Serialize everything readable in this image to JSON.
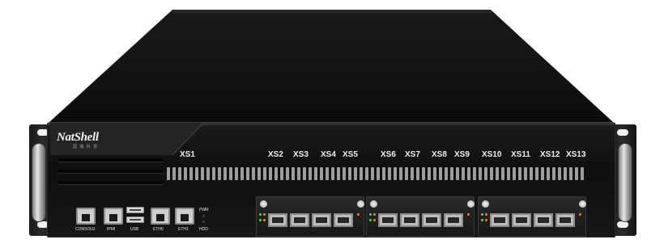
{
  "brand": {
    "logo_text": "NatShell",
    "logo_sub": "国 瑞 科 技"
  },
  "ports": {
    "xs_labels": [
      "XS1",
      "XS2",
      "XS3",
      "XS4",
      "XS5",
      "XS6",
      "XS7",
      "XS8",
      "XS9",
      "XS10",
      "XS11",
      "XS12",
      "XS13"
    ]
  },
  "io": {
    "console": "CONSOLE",
    "ipmi": "IPMI",
    "usb": "USB",
    "eth0": "ETH0",
    "eth1": "ETH1",
    "pwr": "PWR",
    "hdd": "HDD"
  },
  "colors": {
    "chassis": "#101010",
    "lid": "#121212",
    "led_green": "#5fbf3a",
    "led_orange": "#e07a22"
  }
}
